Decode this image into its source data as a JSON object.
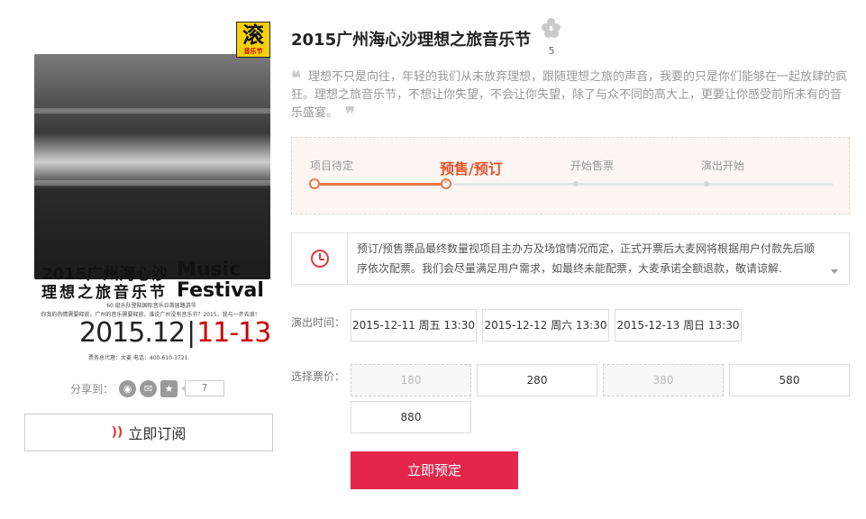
{
  "poster": {
    "logo_char": "滚",
    "logo_sub": "音乐节",
    "title_line1": "2015广州海心沙",
    "title_line2": "理想之旅音乐节",
    "festival_en": "Music Festival",
    "subline1": "60 组乐队登陆国际音乐日首届路游节",
    "subline2": "你我的热情需要释放，广州的音乐需要释放，谁说广州没有音乐节？2015，我与一齐去浪！",
    "date_main": "2015.12",
    "date_sep": "|",
    "date_range": "11-13",
    "tel_line": "票务总代理：大麦    电话：400-610-3721"
  },
  "share": {
    "label": "分享到：",
    "icons": [
      "weibo-icon",
      "wechat-icon",
      "star-icon"
    ],
    "count": "7"
  },
  "subscribe": {
    "label": "立即订阅"
  },
  "event": {
    "title": "2015广州海心沙理想之旅音乐节",
    "fav_count": "5",
    "description": "理想不只是向往，年轻的我们从未放弃理想，跟随理想之旅的声音，我要的只是你们能够在一起放肆的疯狂。理想之旅音乐节，不想让你失望，不会让你失望，除了与众不同的高大上，更要让你感受前所未有的音乐盛宴。"
  },
  "progress": {
    "steps": [
      "项目待定",
      "预售/预订",
      "开始售票",
      "演出开始"
    ],
    "current_index": 1,
    "fill_ratio": 0.255
  },
  "notice": {
    "text": "预订/预售票品最终数量视项目主办方及场馆情况而定，正式开票后大麦网将根据用户付款先后顺序依次配票。我们会尽量满足用户需求，如最终未能配票，大麦承诺全额退款，敬请谅解."
  },
  "showtime": {
    "label": "演出时间：",
    "options": [
      "2015-12-11 周五 13:30",
      "2015-12-12 周六 13:30",
      "2015-12-13 周日 13:30"
    ]
  },
  "prices": {
    "label": "选择票价：",
    "options": [
      {
        "value": "180",
        "available": false
      },
      {
        "value": "280",
        "available": true
      },
      {
        "value": "380",
        "available": false
      },
      {
        "value": "580",
        "available": true
      },
      {
        "value": "880",
        "available": true
      }
    ]
  },
  "buy_button": {
    "label": "立即预定"
  },
  "colors": {
    "accent": "#e4264a",
    "progress": "#e8794a",
    "active_step": "#e8512b"
  }
}
